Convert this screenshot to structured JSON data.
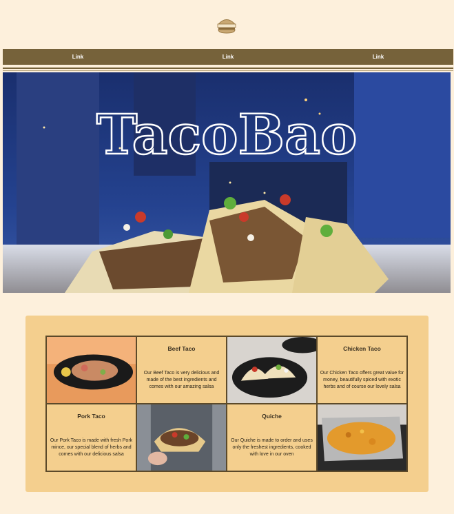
{
  "header": {
    "logo_icon": "burger-logo-icon"
  },
  "nav": {
    "links": [
      {
        "label": "Link"
      },
      {
        "label": "Link"
      },
      {
        "label": "Link"
      }
    ]
  },
  "hero": {
    "title": "TacoBao"
  },
  "menu": {
    "items": [
      {
        "title": "Beef Taco",
        "description": "Our Beef Taco is very delicious and made of the best ingredients and comes with our amazing salsa"
      },
      {
        "title": "Chicken Taco",
        "description": "Our Chicken Taco offers great value for money, beautifully spiced with exotic herbs and of course our lovely salsa"
      },
      {
        "title": "Pork Taco",
        "description": "Our Pork Taco is made with fresh Pork mince, our special blend of herbs and comes with our delicious salsa"
      },
      {
        "title": "Quiche",
        "description": "Our Quiche is made to order and uses only the freshest ingredients, cooked with love in our oven"
      }
    ]
  },
  "colors": {
    "background": "#fdf0dc",
    "nav": "#76623a",
    "panel": "#f4cf8e"
  }
}
